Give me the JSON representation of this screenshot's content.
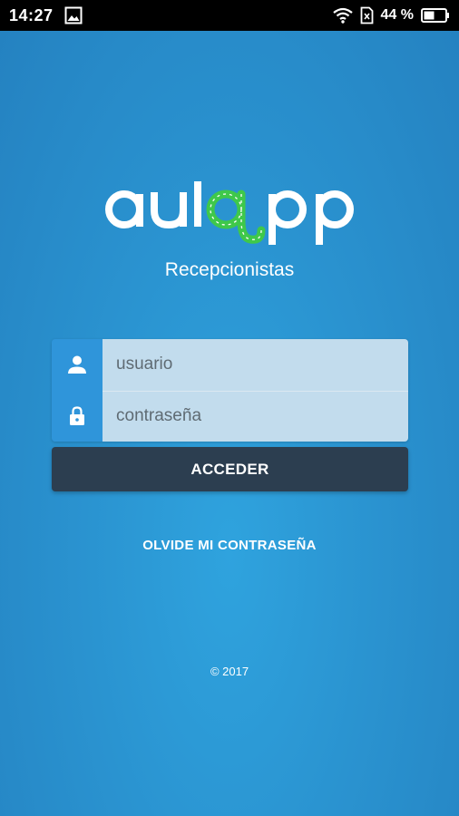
{
  "status_bar": {
    "time": "14:27",
    "battery_percent": "44 %",
    "icons": [
      "image-icon",
      "wifi-icon",
      "sim-icon",
      "battery-icon"
    ]
  },
  "app": {
    "logo_text": "aulapp",
    "subtitle": "Recepcionistas"
  },
  "login": {
    "username_placeholder": "usuario",
    "password_placeholder": "contraseña",
    "icons": [
      "user-icon",
      "lock-icon"
    ],
    "submit_label": "ACCEDER",
    "forgot_label": "OLVIDE MI CONTRASEÑA"
  },
  "footer": {
    "copyright": "© 2017"
  },
  "colors": {
    "background": "#2a93d0",
    "icon_column": "#2f95da",
    "field_background": "#c2dced",
    "button": "#2c3e50",
    "logo_accent": "#3fc84a"
  }
}
